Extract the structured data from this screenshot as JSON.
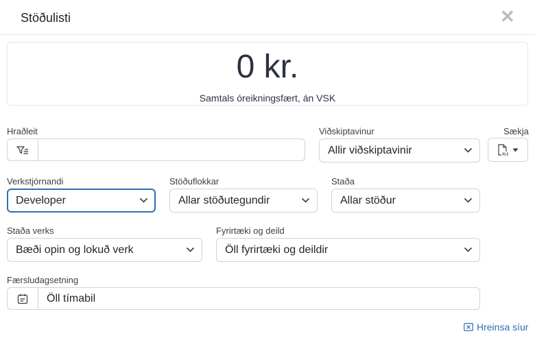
{
  "header": {
    "title": "Stöðulisti",
    "close_glyph": "✕"
  },
  "summary": {
    "amount": "0 kr.",
    "caption": "Samtals óreikningsfært, án VSK"
  },
  "filters": {
    "quick_search": {
      "label": "Hraðleit",
      "value": "",
      "placeholder": "",
      "icon": "filter-list-icon"
    },
    "customer": {
      "label": "Viðskiptavinur",
      "value": "Allir viðskiptavinir"
    },
    "download": {
      "label": "Sækja",
      "icon": "xls-file-icon"
    },
    "project_manager": {
      "label": "Verkstjórnandi",
      "value": "Developer"
    },
    "status_category": {
      "label": "Stöðuflokkar",
      "value": "Allar stöðutegundir"
    },
    "status": {
      "label": "Staða",
      "value": "Allar stöður"
    },
    "project_status": {
      "label": "Staða verks",
      "value": "Bæði opin og lokuð verk"
    },
    "company_department": {
      "label": "Fyrirtæki og deild",
      "value": "Öll fyrirtæki og deildir"
    },
    "posting_date": {
      "label": "Færsludagsetning",
      "value": "Öll tímabil",
      "icon": "calendar-icon"
    }
  },
  "actions": {
    "clear_filters": "Hreinsa síur",
    "clear_icon": "clear-filter-icon"
  },
  "colors": {
    "accent": "#2f6fb2",
    "text": "#212529",
    "border": "#ced4da",
    "muted": "#b9bcc0"
  }
}
